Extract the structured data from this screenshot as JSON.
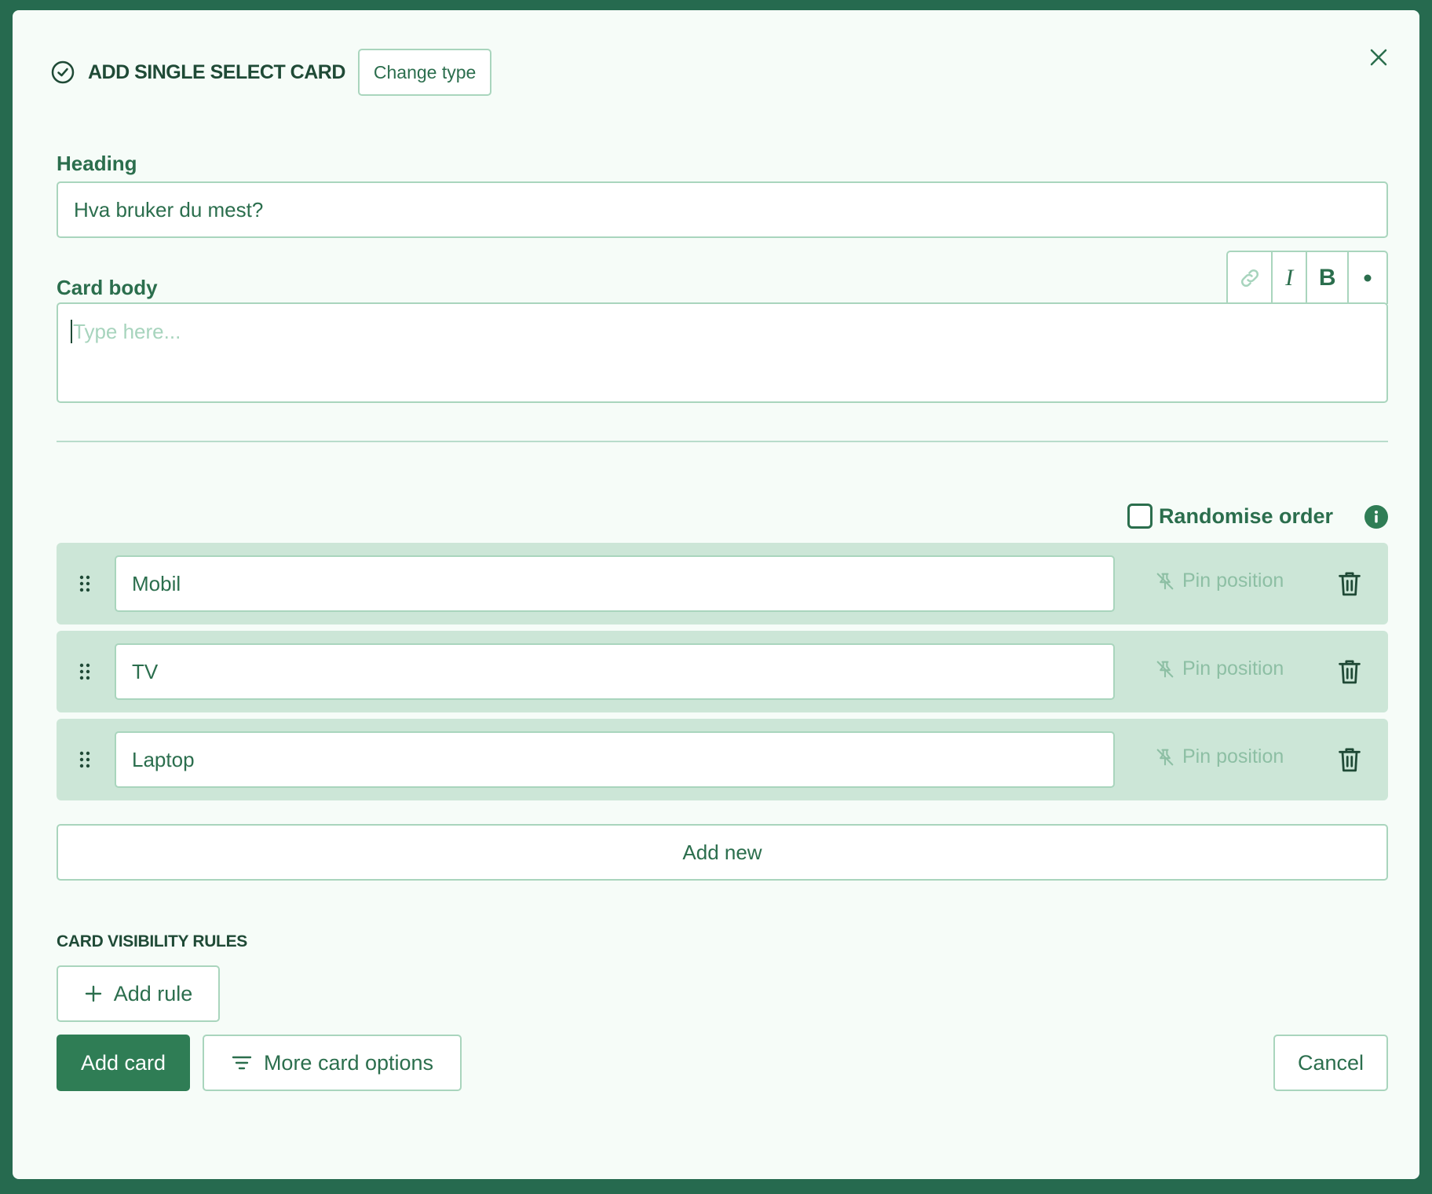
{
  "header": {
    "title": "ADD SINGLE SELECT CARD",
    "change_type_label": "Change type"
  },
  "heading": {
    "label": "Heading",
    "value": "Hva bruker du mest?"
  },
  "card_body": {
    "label": "Card body",
    "placeholder": "Type here...",
    "toolbar": {
      "italic_label": "I",
      "bold_label": "B"
    }
  },
  "randomise": {
    "label": "Randomise order",
    "checked": false
  },
  "options": [
    {
      "value": "Mobil",
      "pin_label": "Pin position"
    },
    {
      "value": "TV",
      "pin_label": "Pin position"
    },
    {
      "value": "Laptop",
      "pin_label": "Pin position"
    }
  ],
  "add_new_label": "Add new",
  "visibility": {
    "title": "CARD VISIBILITY RULES",
    "add_rule_label": "Add rule"
  },
  "footer": {
    "add_card_label": "Add card",
    "more_options_label": "More card options",
    "cancel_label": "Cancel"
  },
  "colors": {
    "accent": "#2f7d55",
    "backdrop": "#266a4f",
    "row_bg": "#cce6d7",
    "border": "#a9d5bd"
  }
}
